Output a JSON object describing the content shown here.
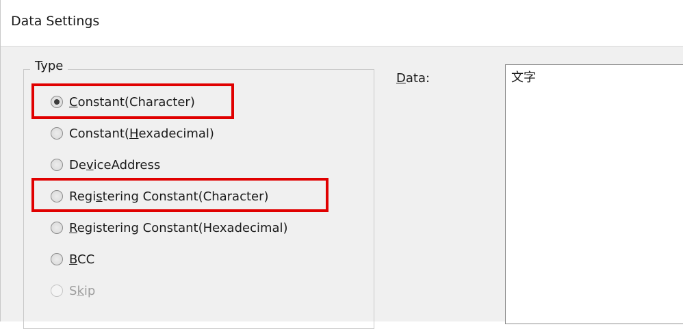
{
  "window": {
    "title": "Data Settings"
  },
  "type_group": {
    "legend": "Type",
    "options": [
      {
        "pre": "",
        "key": "C",
        "post": "onstant(Character)",
        "checked": true,
        "disabled": false
      },
      {
        "pre": "Constant(",
        "key": "H",
        "post": "exadecimal)",
        "checked": false,
        "disabled": false
      },
      {
        "pre": "De",
        "key": "v",
        "post": "iceAddress",
        "checked": false,
        "disabled": false
      },
      {
        "pre": "Regi",
        "key": "s",
        "post": "tering Constant(Character)",
        "checked": false,
        "disabled": false
      },
      {
        "pre": "",
        "key": "R",
        "post": "egistering Constant(Hexadecimal)",
        "checked": false,
        "disabled": false
      },
      {
        "pre": "",
        "key": "B",
        "post": "CC",
        "checked": false,
        "disabled": false
      },
      {
        "pre": "S",
        "key": "k",
        "post": "ip",
        "checked": false,
        "disabled": true
      }
    ]
  },
  "data_field": {
    "label_key": "D",
    "label_rest": "ata:",
    "value": "文字"
  },
  "colors": {
    "highlight": "#e00000",
    "dialog_bg": "#f0f0f0"
  }
}
